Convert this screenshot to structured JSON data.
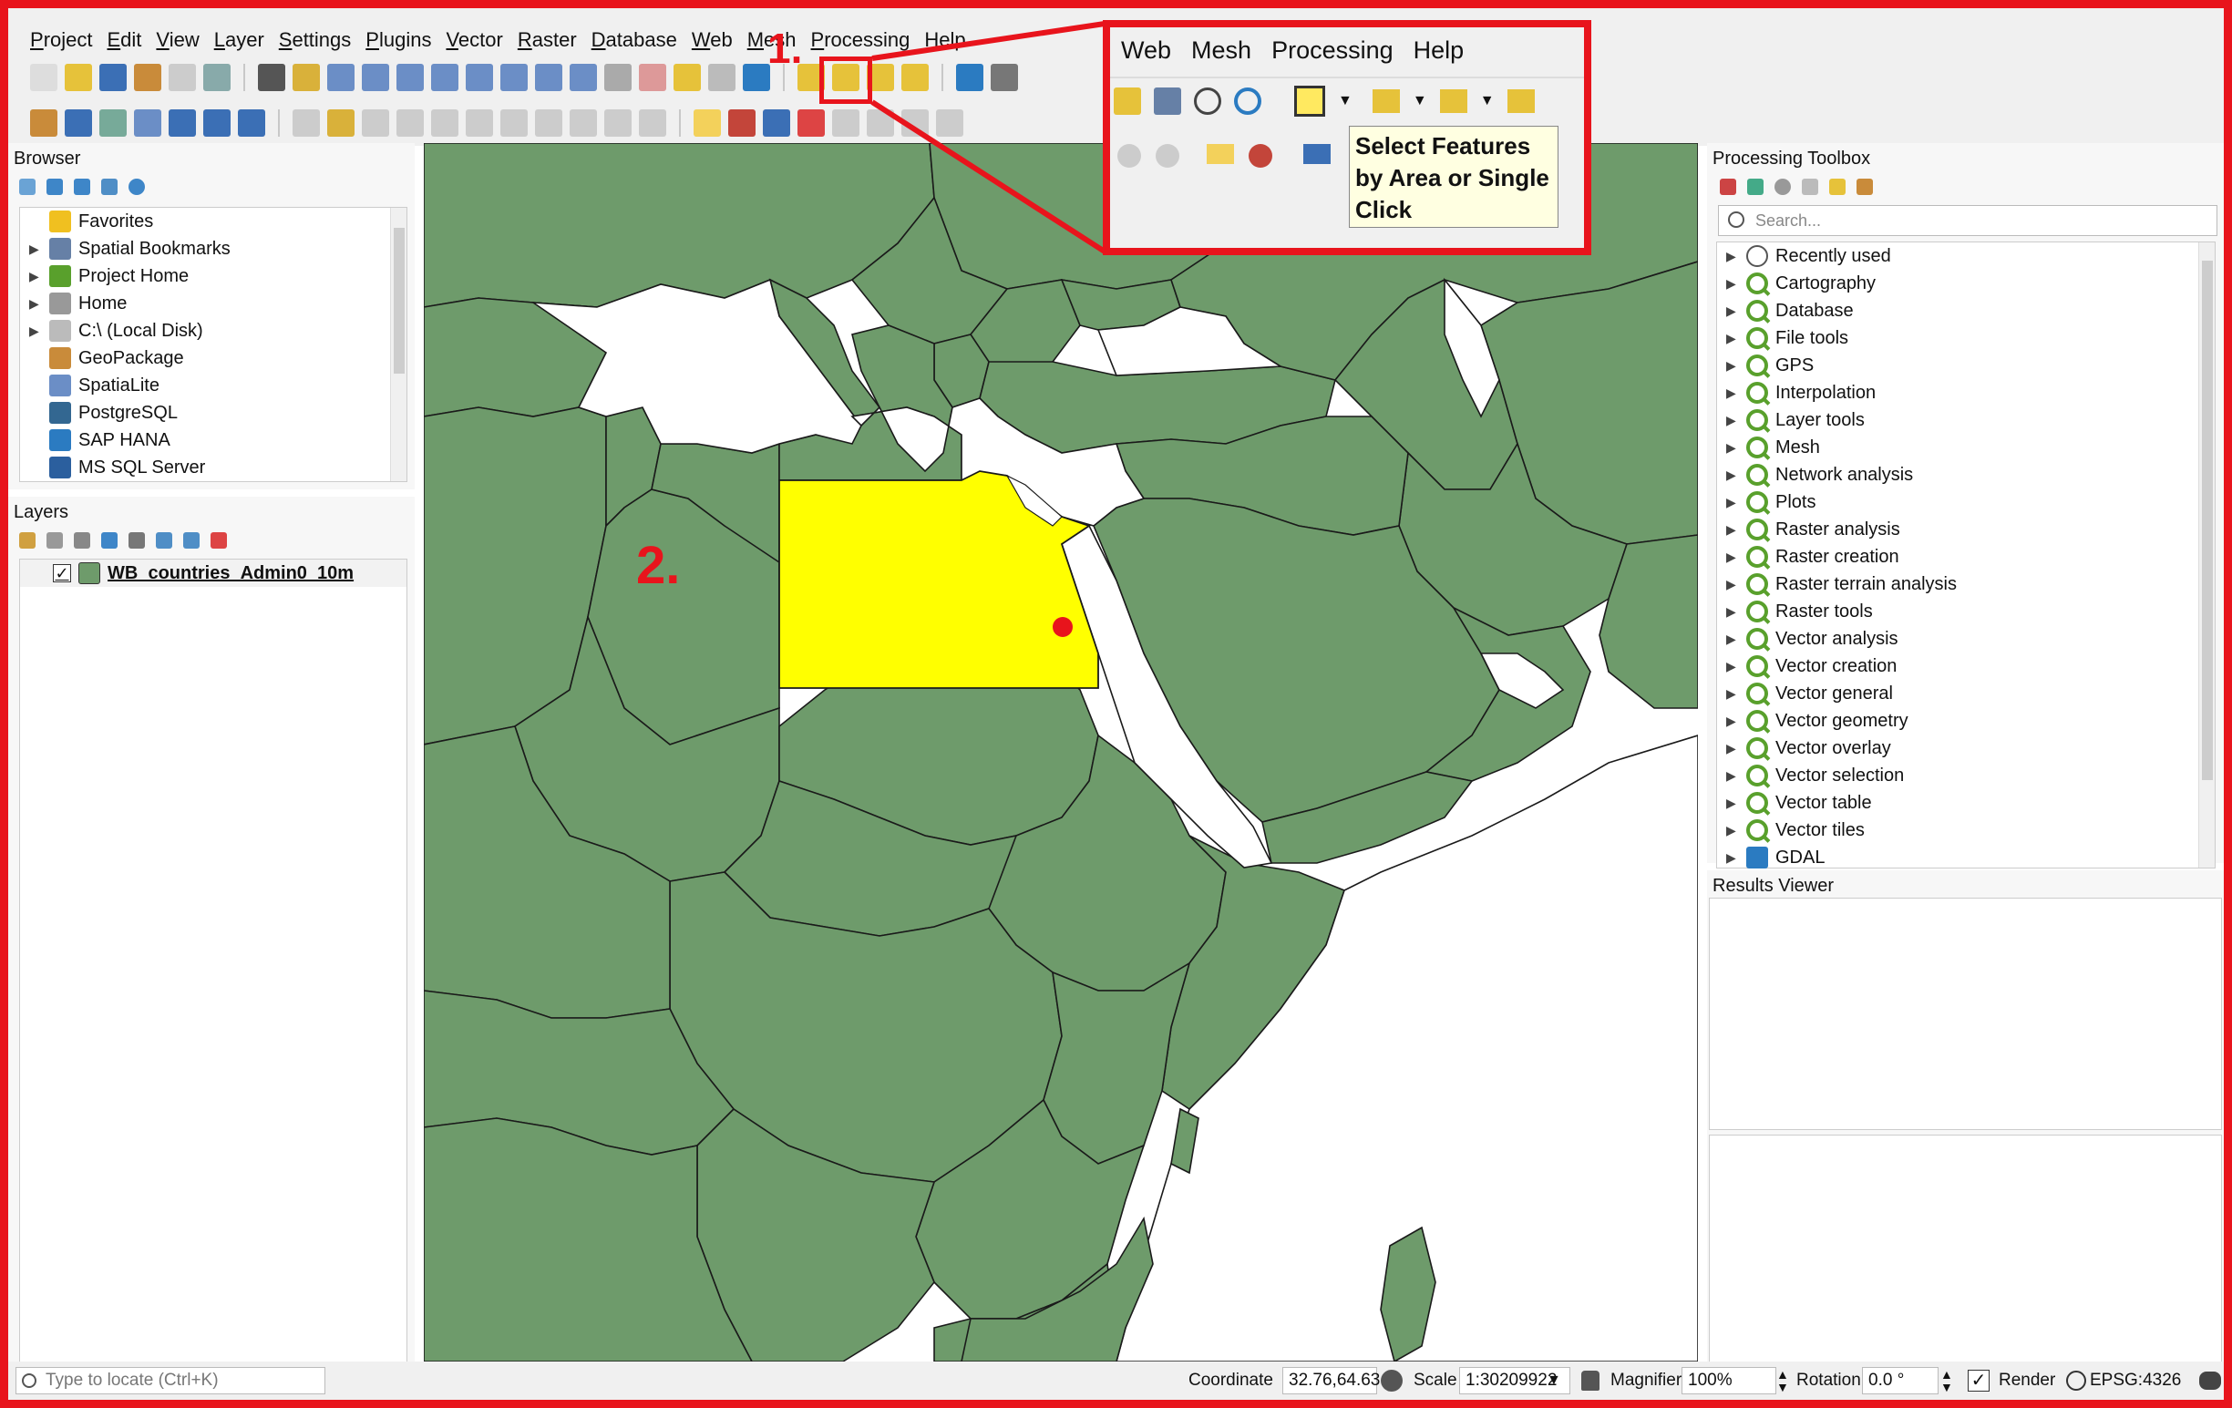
{
  "menu": [
    "Project",
    "Edit",
    "View",
    "Layer",
    "Settings",
    "Plugins",
    "Vector",
    "Raster",
    "Database",
    "Web",
    "Mesh",
    "Processing",
    "Help"
  ],
  "browser": {
    "title": "Browser",
    "items": [
      {
        "label": "Favorites",
        "icon": "star-icon",
        "expandable": false
      },
      {
        "label": "Spatial Bookmarks",
        "icon": "bookmark-icon",
        "expandable": true
      },
      {
        "label": "Project Home",
        "icon": "project-home-icon",
        "expandable": true
      },
      {
        "label": "Home",
        "icon": "home-folder-icon",
        "expandable": true
      },
      {
        "label": "C:\\ (Local Disk)",
        "icon": "disk-icon",
        "expandable": true
      },
      {
        "label": "GeoPackage",
        "icon": "geopackage-icon",
        "expandable": false
      },
      {
        "label": "SpatiaLite",
        "icon": "spatialite-icon",
        "expandable": false
      },
      {
        "label": "PostgreSQL",
        "icon": "postgresql-icon",
        "expandable": false
      },
      {
        "label": "SAP HANA",
        "icon": "sap-hana-icon",
        "expandable": false
      },
      {
        "label": "MS SQL Server",
        "icon": "mssql-icon",
        "expandable": false
      }
    ]
  },
  "layers": {
    "title": "Layers",
    "items": [
      {
        "label": "WB_countries_Admin0_10m",
        "checked": true,
        "color": "#6e9b6b"
      }
    ]
  },
  "processing": {
    "title": "Processing Toolbox",
    "search_placeholder": "Search...",
    "items": [
      "Recently used",
      "Cartography",
      "Database",
      "File tools",
      "GPS",
      "Interpolation",
      "Layer tools",
      "Mesh",
      "Network analysis",
      "Plots",
      "Raster analysis",
      "Raster creation",
      "Raster terrain analysis",
      "Raster tools",
      "Vector analysis",
      "Vector creation",
      "Vector general",
      "Vector geometry",
      "Vector overlay",
      "Vector selection",
      "Vector table",
      "Vector tiles",
      "GDAL"
    ]
  },
  "results": {
    "title": "Results Viewer"
  },
  "callout": {
    "menu": [
      "Web",
      "Mesh",
      "Processing",
      "Help"
    ],
    "tooltip": "Select Features by Area or Single Click"
  },
  "annotations": {
    "step1": "1.",
    "step2": "2."
  },
  "status": {
    "locate_placeholder": "Type to locate (Ctrl+K)",
    "coordinate_label": "Coordinate",
    "coordinate_value": "32.76,64.63",
    "scale_label": "Scale",
    "scale_value": "1:30209922",
    "magnifier_label": "Magnifier",
    "magnifier_value": "100%",
    "rotation_label": "Rotation",
    "rotation_value": "0.0 °",
    "render_label": "Render",
    "crs": "EPSG:4326"
  },
  "colors": {
    "land": "#6e9b6b",
    "selected": "#ffff00",
    "accent": "#e8141c"
  }
}
